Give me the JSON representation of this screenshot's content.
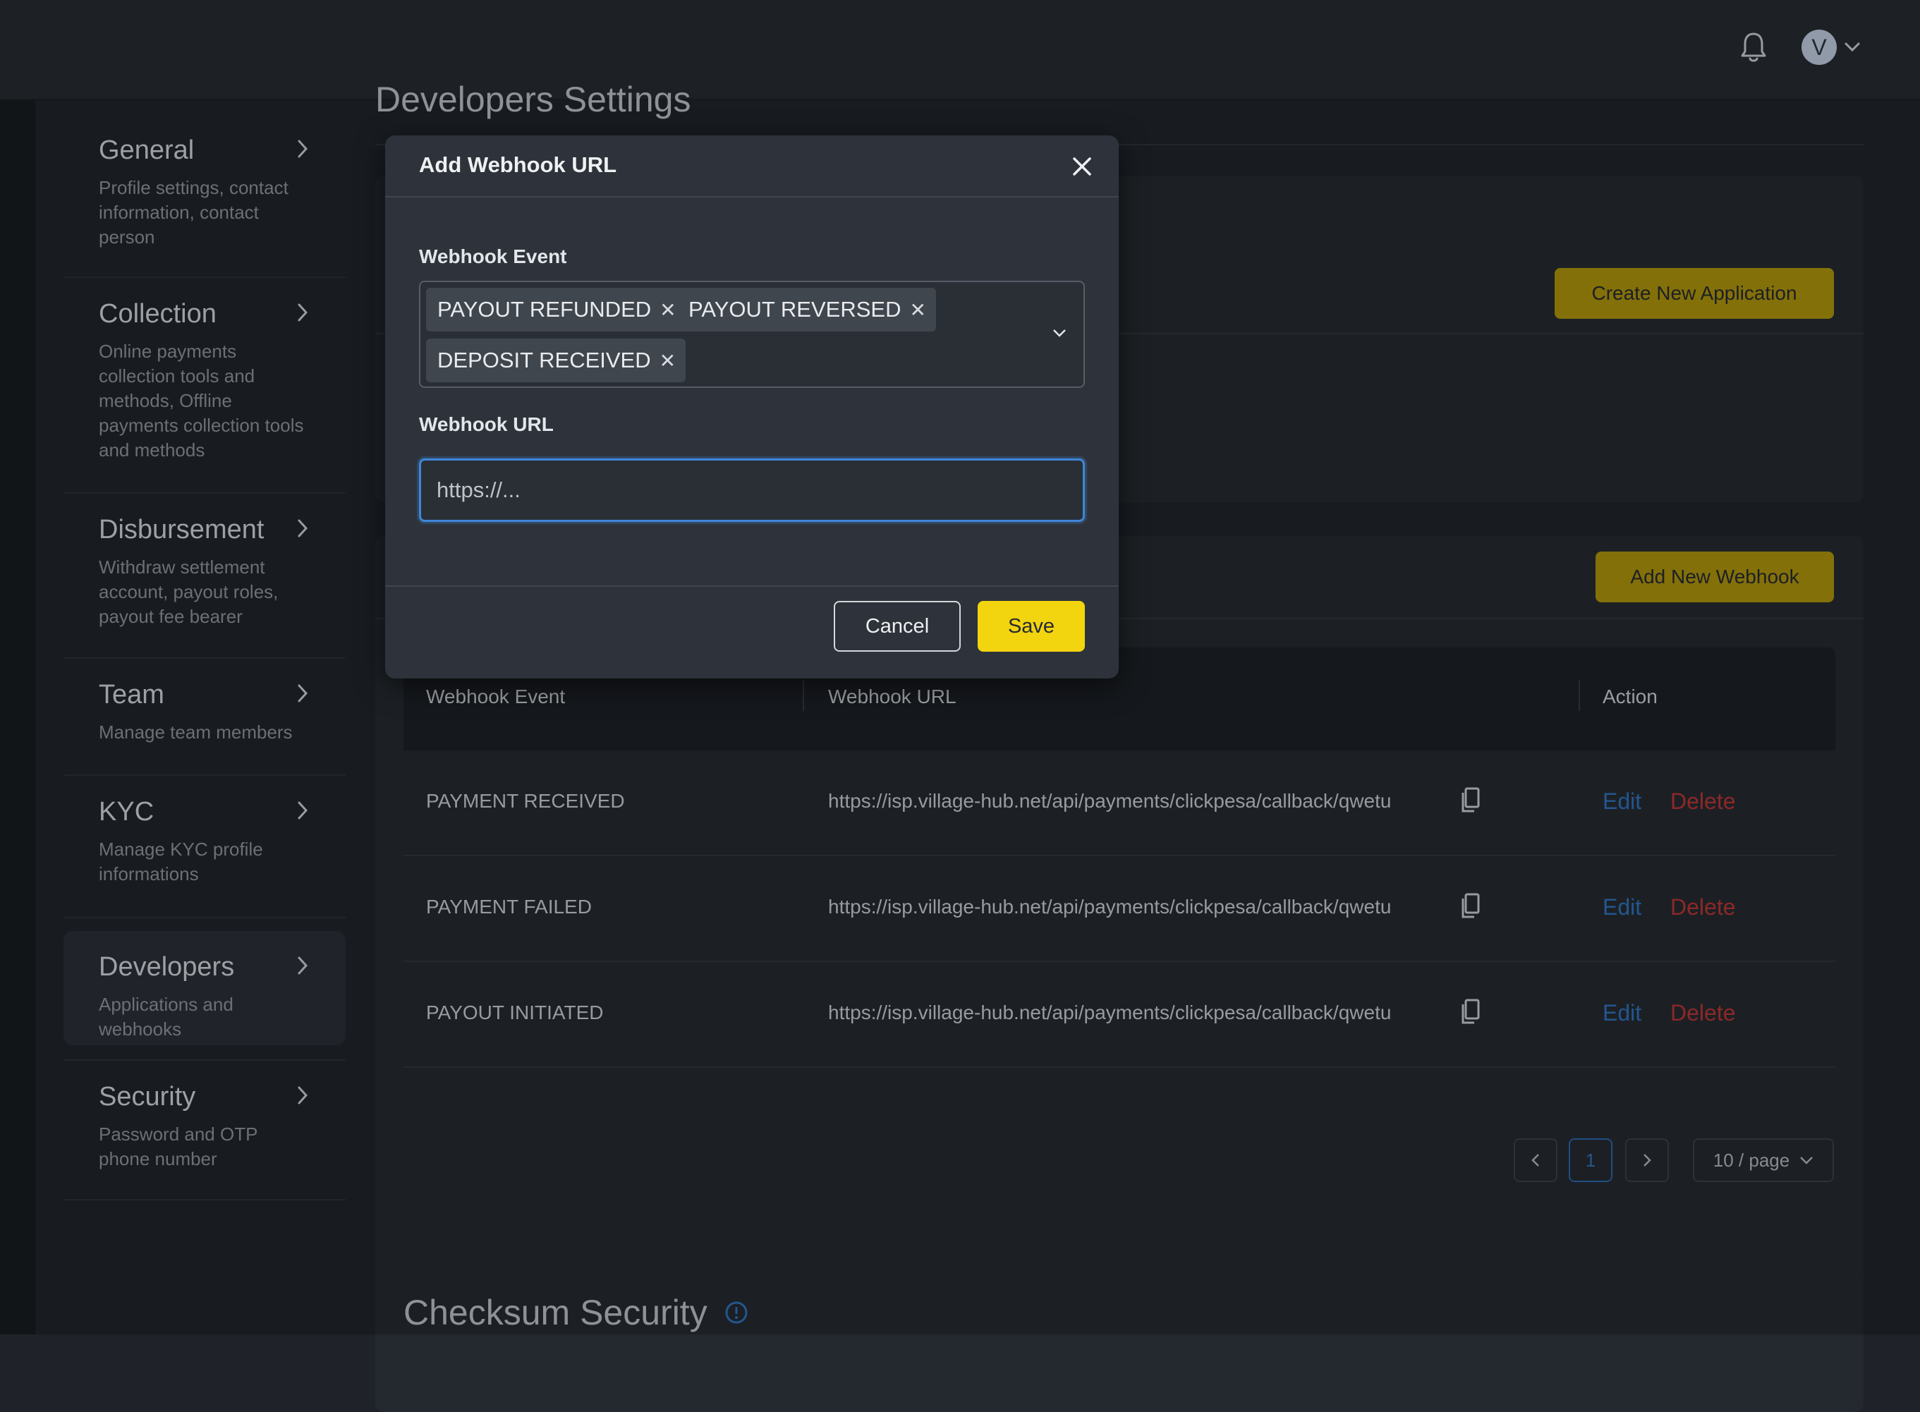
{
  "header": {
    "notification_icon": "bell-icon",
    "avatar_initial": "V",
    "avatar_menu_icon": "chevron-down-icon"
  },
  "sidebar": {
    "items": [
      {
        "title": "General",
        "desc": "Profile settings, contact information, contact person"
      },
      {
        "title": "Collection",
        "desc": "Online payments collection tools and methods, Offline payments collection tools and methods"
      },
      {
        "title": "Disbursement",
        "desc": "Withdraw settlement account, payout roles, payout fee bearer"
      },
      {
        "title": "Team",
        "desc": "Manage team members"
      },
      {
        "title": "KYC",
        "desc": "Manage KYC profile informations"
      },
      {
        "title": "Developers",
        "desc": "Applications and webhooks",
        "active": true
      },
      {
        "title": "Security",
        "desc": "Password and OTP phone number"
      }
    ]
  },
  "main": {
    "page_title": "Developers Settings",
    "create_app_label": "Create New Application",
    "add_webhook_label": "Add New Webhook",
    "table": {
      "headers": [
        "Webhook Event",
        "Webhook URL",
        "Action"
      ],
      "rows": [
        {
          "event": "PAYMENT RECEIVED",
          "url": "https://isp.village-hub.net/api/payments/clickpesa/callback/qwetu",
          "edit": "Edit",
          "delete": "Delete"
        },
        {
          "event": "PAYMENT FAILED",
          "url": "https://isp.village-hub.net/api/payments/clickpesa/callback/qwetu",
          "edit": "Edit",
          "delete": "Delete"
        },
        {
          "event": "PAYOUT INITIATED",
          "url": "https://isp.village-hub.net/api/payments/clickpesa/callback/qwetu",
          "edit": "Edit",
          "delete": "Delete"
        }
      ]
    },
    "pagination": {
      "current_page": "1",
      "page_size": "10 / page"
    },
    "checksum_title": "Checksum Security"
  },
  "modal": {
    "title": "Add Webhook URL",
    "event_label": "Webhook Event",
    "selected_events": [
      "PAYOUT REFUNDED",
      "PAYOUT REVERSED",
      "DEPOSIT RECEIVED"
    ],
    "url_label": "Webhook URL",
    "url_placeholder": "https://...",
    "cancel_label": "Cancel",
    "save_label": "Save"
  },
  "colors": {
    "accent_gold": "#f2d40f",
    "link_blue": "#2e6fb8",
    "delete_red": "#b43434",
    "focus_blue": "#3f86d8"
  }
}
